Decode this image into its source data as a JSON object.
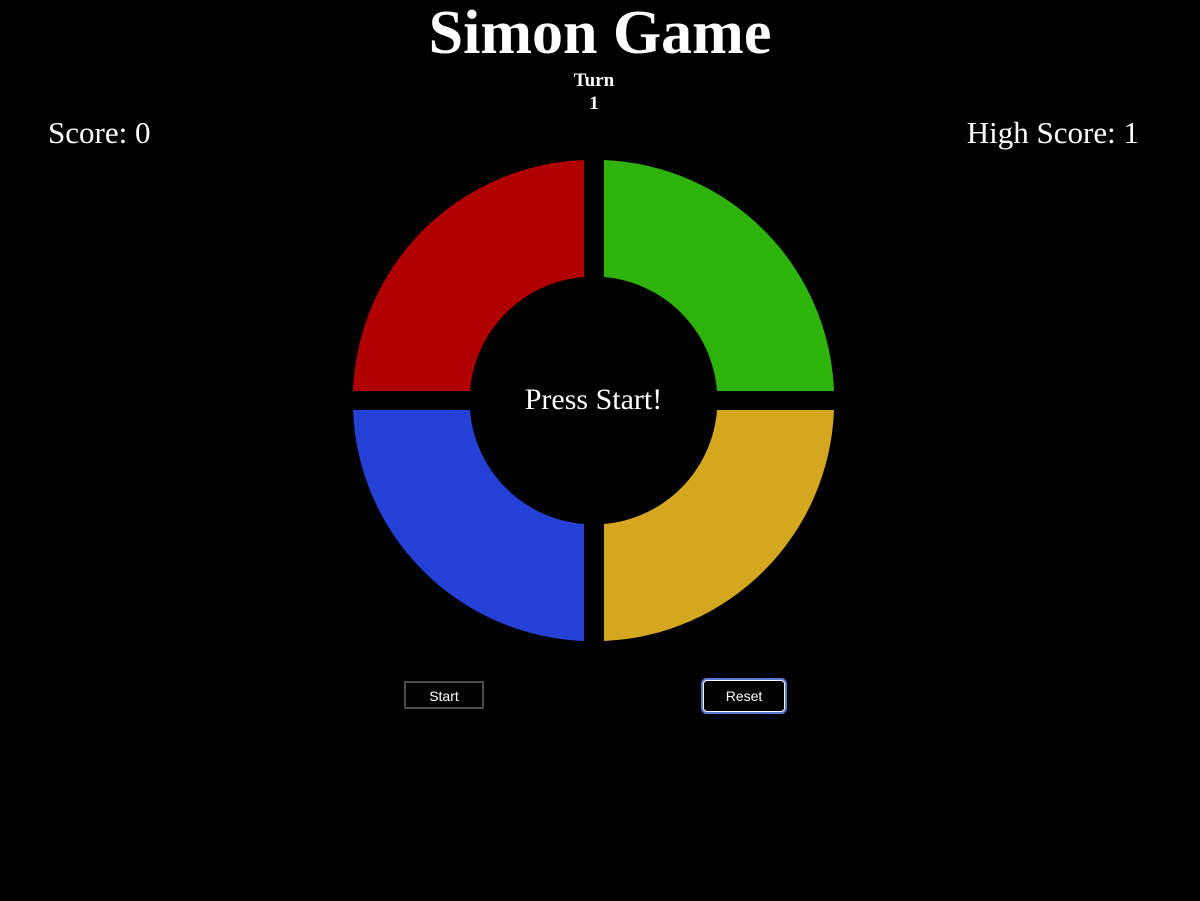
{
  "header": {
    "title": "Simon Game",
    "turn_label": "Turn",
    "turn_value": "1"
  },
  "scoreboard": {
    "score_text": "Score: 0",
    "high_score_text": "High Score: 1"
  },
  "board": {
    "center_message": "Press Start!",
    "pads": [
      {
        "name": "red",
        "color": "#b00000"
      },
      {
        "name": "green",
        "color": "#2db30a"
      },
      {
        "name": "blue",
        "color": "#2540d6"
      },
      {
        "name": "yellow",
        "color": "#d4a71e"
      }
    ]
  },
  "controls": {
    "start_label": "Start",
    "reset_label": "Reset"
  }
}
